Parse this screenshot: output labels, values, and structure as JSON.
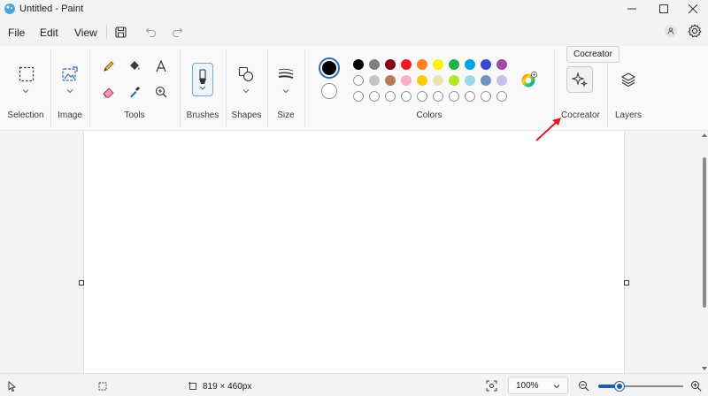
{
  "window": {
    "title": "Untitled - Paint"
  },
  "menu": {
    "file": "File",
    "edit": "Edit",
    "view": "View"
  },
  "ribbon": {
    "groups": {
      "selection": "Selection",
      "image": "Image",
      "tools": "Tools",
      "brushes": "Brushes",
      "shapes": "Shapes",
      "size": "Size",
      "colors": "Colors",
      "cocreator": "Cocreator",
      "layers": "Layers"
    },
    "colors": {
      "primary": "#000000",
      "secondary": "#ffffff",
      "palette_row1": [
        "#000000",
        "#7f7f7f",
        "#880015",
        "#ed1c24",
        "#ff7f27",
        "#fff200",
        "#22b14c",
        "#00a2e8",
        "#3f48cc",
        "#a349a4"
      ],
      "palette_row2": [
        "#ffffff",
        "#c3c3c3",
        "#b97a57",
        "#ffaec9",
        "#ffc90e",
        "#efe4b0",
        "#b5e61d",
        "#99d9ea",
        "#7092be",
        "#c8bfe7"
      ],
      "palette_row3_empty_count": 10,
      "accent": "#1f5fa8",
      "annotation_arrow": "#e11b22"
    }
  },
  "tooltip": {
    "text": "Cocreator"
  },
  "status": {
    "canvas_size": "819 × 460px",
    "zoom": "100%",
    "zoom_level": 0.25
  }
}
